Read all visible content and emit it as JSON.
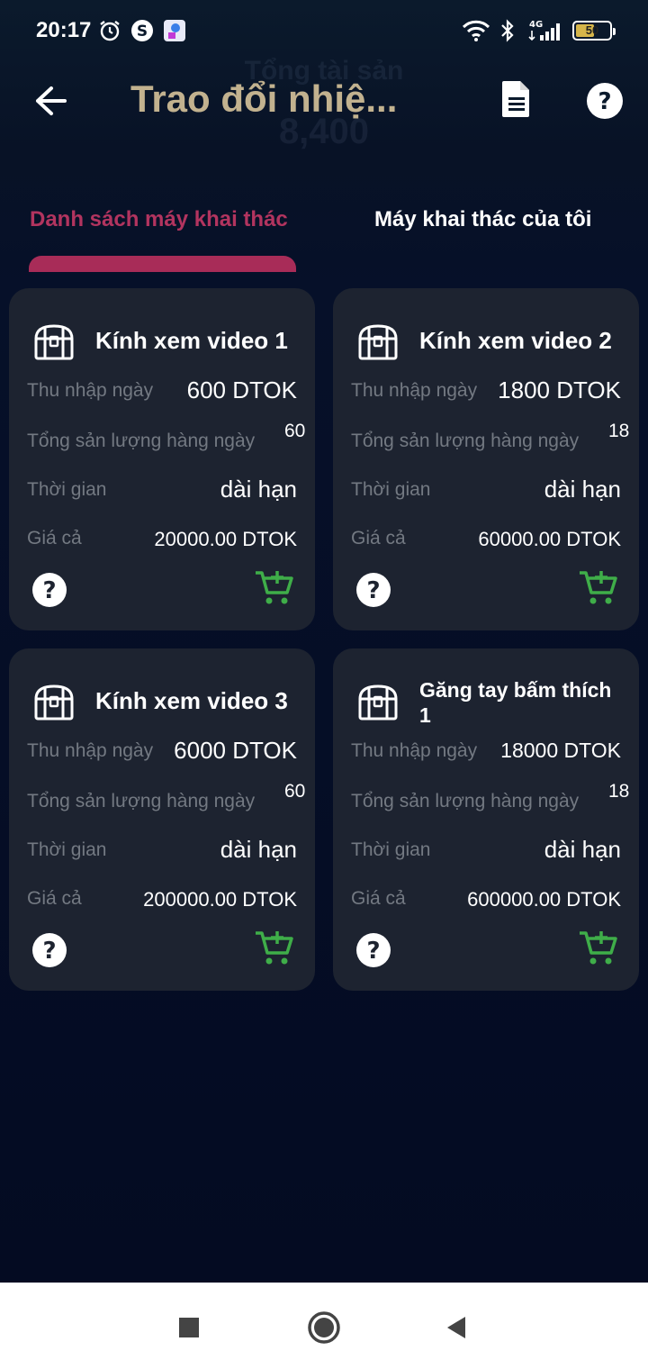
{
  "status_bar": {
    "time": "20:17",
    "network": "4G",
    "battery": "50",
    "battery_level": 0.5,
    "icons": [
      "alarm-icon",
      "s-app-icon",
      "app-icon",
      "wifi-icon",
      "bluetooth-icon",
      "signal-icon",
      "battery-icon"
    ]
  },
  "background": {
    "line1": "Tổng tài sản",
    "line2": "8,400"
  },
  "header": {
    "title": "Trao đổi nhiệ...",
    "icons": [
      "back-arrow-icon",
      "document-icon",
      "help-icon"
    ]
  },
  "tabs": [
    {
      "label": "Danh sách máy khai thác",
      "active": true
    },
    {
      "label": "Máy khai thác của tôi",
      "active": false
    }
  ],
  "colors": {
    "title": "#c2b28f",
    "active_tab": "#b2345f",
    "indicator": "#a82c58",
    "card_bg": "#1d2330",
    "label": "#737982",
    "cart": "#3fae49",
    "battery": "#d6b54a"
  },
  "cards": [
    {
      "title": "Kính xem video 1",
      "daily_income_label": "Thu nhập ngày",
      "daily_income": "600 DTOK",
      "daily_output_label": "Tổng sản lượng hàng ngày",
      "daily_output": "60",
      "duration_label": "Thời gian",
      "duration": "dài hạn",
      "price_label": "Giá cả",
      "price": "20000.00 DTOK"
    },
    {
      "title": "Kính xem video 2",
      "daily_income_label": "Thu nhập ngày",
      "daily_income": "1800 DTOK",
      "daily_output_label": "Tổng sản lượng hàng ngày",
      "daily_output": "18",
      "duration_label": "Thời gian",
      "duration": "dài hạn",
      "price_label": "Giá cả",
      "price": "60000.00 DTOK"
    },
    {
      "title": "Kính xem video 3",
      "daily_income_label": "Thu nhập ngày",
      "daily_income": "6000 DTOK",
      "daily_output_label": "Tổng sản lượng hàng ngày",
      "daily_output": "60",
      "duration_label": "Thời gian",
      "duration": "dài hạn",
      "price_label": "Giá cả",
      "price": "200000.00 DTOK"
    },
    {
      "title": "Găng tay bấm thích 1",
      "daily_income_label": "Thu nhập ngày",
      "daily_income": "18000 DTOK",
      "daily_output_label": "Tổng sản lượng hàng ngày",
      "daily_output": "18",
      "duration_label": "Thời gian",
      "duration": "dài hạn",
      "price_label": "Giá cả",
      "price": "600000.00 DTOK"
    }
  ],
  "card_icons": [
    "treasure-chest-icon",
    "help-icon",
    "add-to-cart-icon"
  ],
  "navbar": {
    "icons": [
      "recent-apps-icon",
      "home-icon",
      "back-icon"
    ]
  }
}
